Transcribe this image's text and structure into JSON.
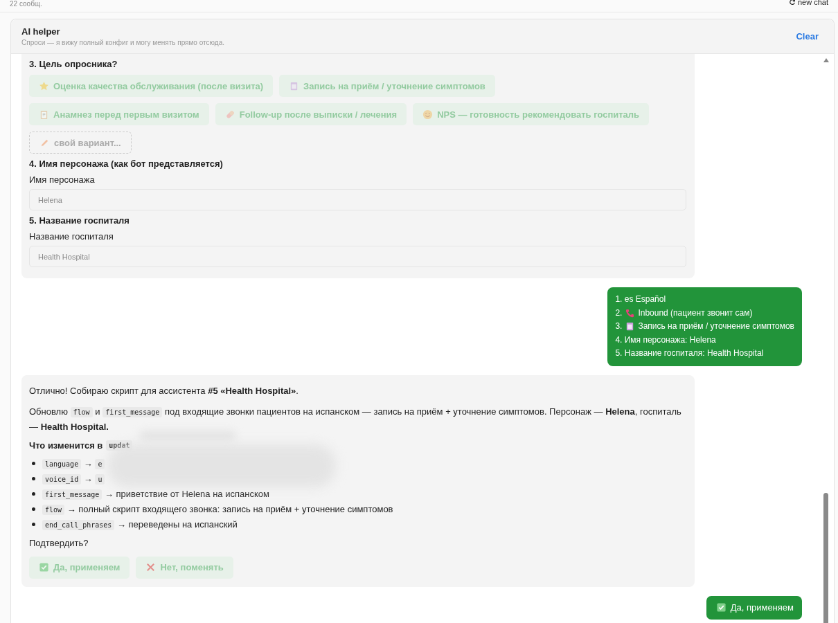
{
  "top_bar": {
    "count": "22 сообщ.",
    "new_chat": "new chat"
  },
  "panel": {
    "title": "AI helper",
    "subtitle": "Спроси — я вижу полный конфиг и могу менять прямо отсюда.",
    "clear": "Clear"
  },
  "form_message": {
    "question": "3. Цель опросника?",
    "options": [
      {
        "kind": "star",
        "label": "Оценка качества обслуживания (после визита)",
        "disabled": true
      },
      {
        "kind": "calendar",
        "label": "Запись на приём / уточнение симптомов",
        "disabled": true
      },
      {
        "kind": "clipboard",
        "label": "Анамнез перед первым визитом",
        "disabled": true
      },
      {
        "kind": "pill",
        "label": "Follow-up после выписки / лечения",
        "disabled": true
      },
      {
        "kind": "smile",
        "label": "NPS — готовность рекомендовать госпиталь",
        "disabled": true
      }
    ],
    "custom_option": "свой вариант...",
    "fields": [
      {
        "title": "4. Имя персонажа (как бот представляется)",
        "label": "Имя персонажа",
        "value": "Helena"
      },
      {
        "title": "5. Название госпиталя",
        "label": "Название госпиталя",
        "value": "Health Hospital"
      }
    ]
  },
  "user_answer": {
    "lines": [
      {
        "kind": "plain",
        "text": "1. es Español"
      },
      {
        "kind": "phone",
        "prefix": "2.",
        "text": "Inbound (пациент звонит сам)"
      },
      {
        "kind": "calendar",
        "prefix": "3.",
        "text": "Запись на приём / уточнение симптомов"
      },
      {
        "kind": "plain",
        "text": "4. Имя персонажа: Helena"
      },
      {
        "kind": "plain",
        "text": "5. Название госпиталя: Health Hospital"
      }
    ]
  },
  "summary_message": {
    "intro": "Отлично! Собираю скрипт для ассистента **#5 «Health Hospital»**.",
    "paragraph": [
      {
        "kind": "text",
        "text": "Обновлю "
      },
      {
        "kind": "code",
        "text": "flow"
      },
      {
        "kind": "text",
        "text": " и "
      },
      {
        "kind": "code",
        "text": "first_message"
      },
      {
        "kind": "text",
        "text": " под входящие звонки пациентов на испанском — запись на приём + уточнение симптомов. Персонаж — **Helena**, госпиталь — **Health Hospital.**"
      }
    ],
    "changes_title": "Что изменится в",
    "changes_code": "updat",
    "changes": [
      [
        {
          "kind": "code",
          "text": "language"
        },
        {
          "kind": "text",
          "text": " → "
        },
        {
          "kind": "code",
          "text": "e"
        }
      ],
      [
        {
          "kind": "code",
          "text": "voice_id"
        },
        {
          "kind": "text",
          "text": " → "
        },
        {
          "kind": "code",
          "text": "u"
        }
      ],
      [
        {
          "kind": "code",
          "text": "first_message"
        },
        {
          "kind": "text",
          "text": " → приветствие от Helena на испанском"
        }
      ],
      [
        {
          "kind": "code",
          "text": "flow"
        },
        {
          "kind": "text",
          "text": " → полный скрипт входящего звонка: запись на приём + уточнение симптомов"
        }
      ],
      [
        {
          "kind": "code",
          "text": "end_call_phrases"
        },
        {
          "kind": "text",
          "text": " → переведены на испанский"
        }
      ]
    ],
    "confirm": "Подтвердить?",
    "actions": [
      {
        "kind": "confirm",
        "label": "Да, применяем",
        "disabled": true
      },
      {
        "kind": "reject",
        "label": "Нет, поменять",
        "disabled": true
      }
    ]
  },
  "user_reply": {
    "kind": "confirm",
    "label": "Да, применяем"
  }
}
